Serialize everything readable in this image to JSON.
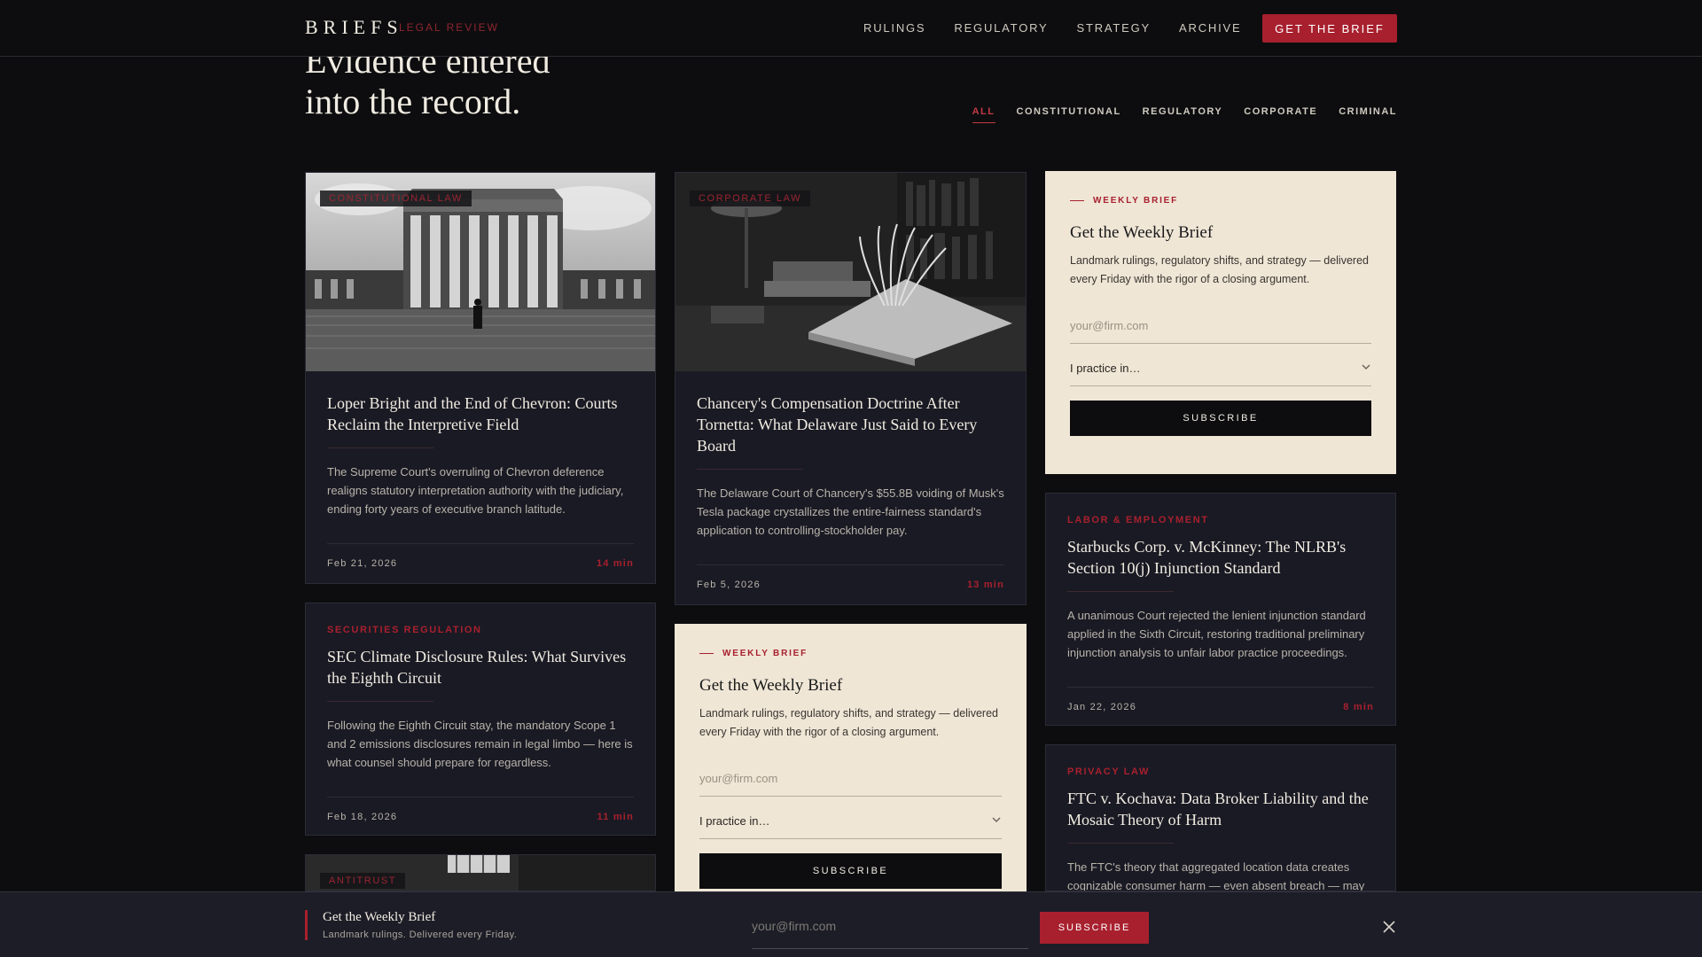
{
  "header": {
    "logo": "BRIEFS",
    "logo_sub": "LEGAL REVIEW",
    "nav": [
      "RULINGS",
      "REGULATORY",
      "STRATEGY",
      "ARCHIVE"
    ],
    "cta": "GET THE BRIEF"
  },
  "hero": {
    "line1": "Evidence entered",
    "line2": "into the record."
  },
  "filters": [
    "ALL",
    "CONSTITUTIONAL",
    "REGULATORY",
    "CORPORATE",
    "CRIMINAL"
  ],
  "cards": [
    {
      "tag": "CONSTITUTIONAL LAW",
      "title": "Loper Bright and the End of Chevron: Courts Reclaim the Interpretive Field",
      "excerpt": "The Supreme Court's overruling of Chevron deference realigns statutory interpretation authority with the judiciary, ending forty years of executive branch latitude.",
      "date": "Feb 21, 2026",
      "mins": "14 min"
    },
    {
      "tag": "CORPORATE LAW",
      "title": "Chancery's Compensation Doctrine After Tornetta: What Delaware Just Said to Every Board",
      "excerpt": "The Delaware Court of Chancery's $55.8B voiding of Musk's Tesla package crystallizes the entire-fairness standard's application to controlling-stockholder pay.",
      "date": "Feb 5, 2026",
      "mins": "13 min"
    },
    {
      "tag": "SECURITIES REGULATION",
      "title": "SEC Climate Disclosure Rules: What Survives the Eighth Circuit",
      "excerpt": "Following the Eighth Circuit stay, the mandatory Scope 1 and 2 emissions disclosures remain in legal limbo — here is what counsel should prepare for regardless.",
      "date": "Feb 18, 2026",
      "mins": "11 min"
    },
    {
      "tag": "LABOR & EMPLOYMENT",
      "title": "Starbucks Corp. v. McKinney: The NLRB's Section 10(j) Injunction Standard",
      "excerpt": "A unanimous Court rejected the lenient injunction standard applied in the Sixth Circuit, restoring traditional preliminary injunction analysis to unfair labor practice proceedings.",
      "date": "Jan 22, 2026",
      "mins": "8 min"
    },
    {
      "tag": "PRIVACY LAW",
      "title": "FTC v. Kochava: Data Broker Liability and the Mosaic Theory of Harm",
      "excerpt": "The FTC's theory that aggregated location data creates cognizable consumer harm — even absent breach — may"
    },
    {
      "tag": "ANTITRUST"
    }
  ],
  "newsletter": {
    "kicker": "WEEKLY BRIEF",
    "title": "Get the Weekly Brief",
    "desc": "Landmark rulings, regulatory shifts, and strategy — delivered every Friday with the rigor of a closing argument.",
    "email_placeholder": "your@firm.com",
    "practice_placeholder": "I practice in…",
    "button": "SUBSCRIBE"
  },
  "sticky": {
    "title": "Get the Weekly Brief",
    "sub": "Landmark rulings. Delivered every Friday.",
    "email_placeholder": "your@firm.com",
    "button": "SUBSCRIBE"
  },
  "icons": {
    "chevron": "chevron-down-icon",
    "close": "close-icon"
  }
}
